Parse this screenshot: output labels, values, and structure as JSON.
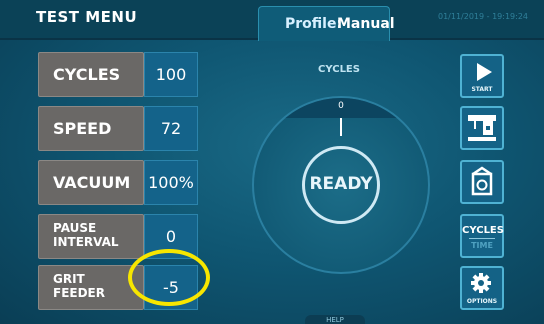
{
  "header": {
    "title": "TEST MENU",
    "profile_label": "Profile:",
    "profile_value": "Manual",
    "datetime": "01/11/2019 - 19:19:24"
  },
  "params": [
    {
      "label": "CYCLES",
      "value": "100"
    },
    {
      "label": "SPEED",
      "value": "72"
    },
    {
      "label": "VACUUM",
      "value": "100%"
    },
    {
      "label_line1": "PAUSE",
      "label_line2": "INTERVAL",
      "value": "0"
    },
    {
      "label_line1": "GRIT",
      "label_line2": "FEEDER",
      "value": "-5"
    }
  ],
  "dial": {
    "caption": "CYCLES",
    "zero_label": "0",
    "status": "READY"
  },
  "side_buttons": {
    "start_label": "START",
    "cycles_label": "CYCLES",
    "time_label": "TIME",
    "options_label": "OPTIONS"
  },
  "footer": {
    "help_label": "HELP"
  },
  "colors": {
    "highlight_ring": "#f7e600",
    "accent": "#4fb2d3"
  }
}
